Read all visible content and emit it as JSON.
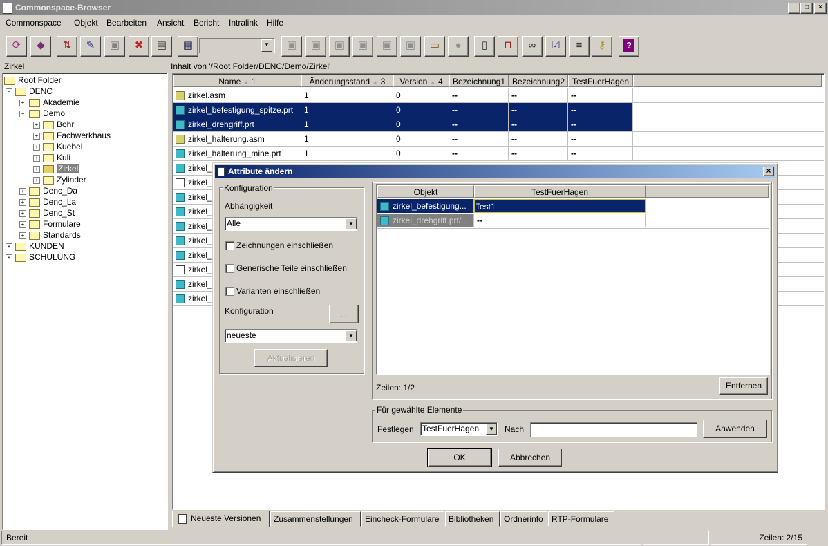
{
  "window": {
    "title": "Commonspace-Browser",
    "btn_min": "_",
    "btn_max": "□",
    "btn_close": "×"
  },
  "menu": [
    "Commonspace",
    "Objekt",
    "Bearbeiten",
    "Ansicht",
    "Bericht",
    "Intralink",
    "Hilfe"
  ],
  "tree": {
    "header": "Zirkel",
    "nodes": [
      {
        "label": "Root Folder"
      },
      {
        "label": "DENC"
      },
      {
        "label": "Akademie"
      },
      {
        "label": "Demo"
      },
      {
        "label": "Bohr"
      },
      {
        "label": "Fachwerkhaus"
      },
      {
        "label": "Kuebel"
      },
      {
        "label": "Kuli"
      },
      {
        "label": "Zirkel"
      },
      {
        "label": "Zylinder"
      },
      {
        "label": "Denc_Da"
      },
      {
        "label": "Denc_La"
      },
      {
        "label": "Denc_St"
      },
      {
        "label": "Formulare"
      },
      {
        "label": "Standards"
      },
      {
        "label": "KUNDEN"
      },
      {
        "label": "SCHULUNG"
      }
    ]
  },
  "content": {
    "path": "Inhalt von '/Root Folder/DENC/Demo/Zirkel'",
    "columns": [
      "Name",
      "Änderungsstand",
      "Version",
      "Bezeichnung1",
      "Bezeichnung2",
      "TestFuerHagen"
    ],
    "sort_marks": [
      "1",
      "3",
      "4"
    ],
    "rows": [
      {
        "name": "zirkel.asm",
        "aend": "1",
        "ver": "0",
        "b1": "--",
        "b2": "--",
        "tfh": "--"
      },
      {
        "name": "zirkel_befestigung_spitze.prt",
        "aend": "1",
        "ver": "0",
        "b1": "--",
        "b2": "--",
        "tfh": "--"
      },
      {
        "name": "zirkel_drehgriff.prt",
        "aend": "1",
        "ver": "0",
        "b1": "--",
        "b2": "--",
        "tfh": "--"
      },
      {
        "name": "zirkel_halterung.asm",
        "aend": "1",
        "ver": "0",
        "b1": "--",
        "b2": "--",
        "tfh": "--"
      },
      {
        "name": "zirkel_halterung_mine.prt",
        "aend": "1",
        "ver": "0",
        "b1": "--",
        "b2": "--",
        "tfh": "--"
      },
      {
        "name": "zirkel_"
      },
      {
        "name": "zirkel_"
      },
      {
        "name": "zirkel_"
      },
      {
        "name": "zirkel_"
      },
      {
        "name": "zirkel_"
      },
      {
        "name": "zirkel_"
      },
      {
        "name": "zirkel_"
      },
      {
        "name": "zirkel_"
      },
      {
        "name": "zirkel_"
      },
      {
        "name": "zirkel_"
      }
    ]
  },
  "tabs": [
    "Neueste Versionen",
    "Zusammenstellungen",
    "Eincheck-Formulare",
    "Bibliotheken",
    "Ordnerinfo",
    "RTP-Formulare"
  ],
  "status": {
    "left": "Bereit",
    "right": "Zeilen: 2/15"
  },
  "dialog": {
    "title": "Attribute ändern",
    "close": "×",
    "konfig_group": "Konfiguration",
    "abh_label": "Abhängigkeit",
    "abh_value": "Alle",
    "chk1": "Zeichnungen einschließen",
    "chk2": "Generische Teile einschließen",
    "chk3": "Varianten einschließen",
    "konfig_label": "Konfiguration",
    "konfig_btn": "...",
    "konfig_value": "neueste",
    "aktualisieren": "Aktualisieren",
    "table_cols": [
      "Objekt",
      "TestFuerHagen"
    ],
    "table_rows": [
      {
        "obj": "zirkel_befestigung...",
        "val": "Test1"
      },
      {
        "obj": "zirkel_drehgriff.prt/...",
        "val": "--"
      }
    ],
    "zeilen": "Zeilen: 1/2",
    "entfernen": "Entfernen",
    "fuer_group": "Für gewählte Elemente",
    "festlegen_label": "Festlegen",
    "festlegen_value": "TestFuerHagen",
    "nach_label": "Nach",
    "nach_value": "",
    "anwenden": "Anwenden",
    "ok": "OK",
    "abbrechen": "Abbrechen"
  }
}
